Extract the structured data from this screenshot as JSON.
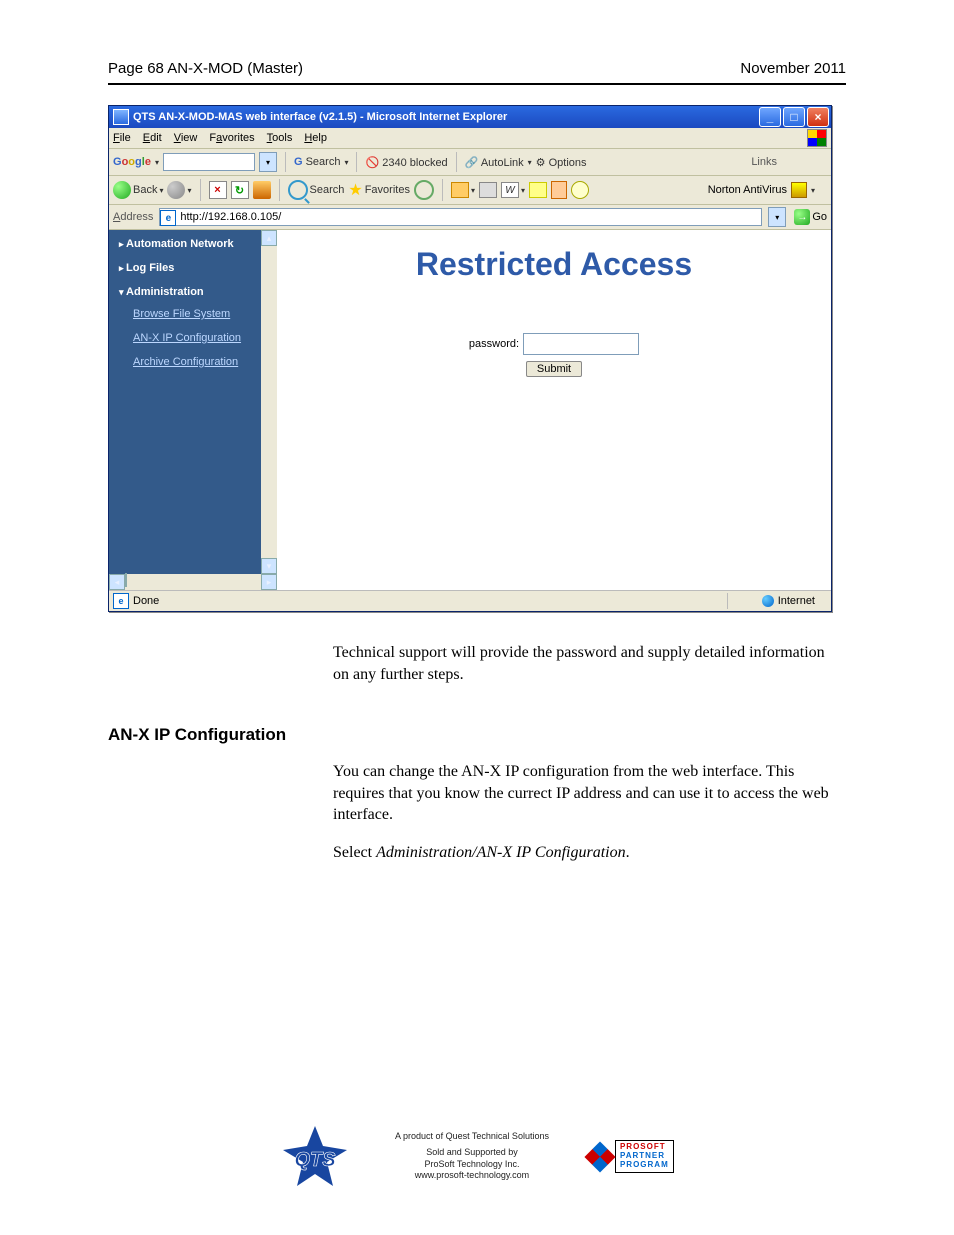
{
  "pageHeader": {
    "left": "Page  68  AN-X-MOD (Master)",
    "right": "November 2011"
  },
  "ieWindow": {
    "title": "QTS AN-X-MOD-MAS web interface (v2.1.5) - Microsoft Internet Explorer",
    "menu": {
      "file": "File",
      "edit": "Edit",
      "view": "View",
      "favorites": "Favorites",
      "tools": "Tools",
      "help": "Help"
    },
    "googleBar": {
      "search": "Search",
      "blocked": "2340 blocked",
      "autolink": "AutoLink",
      "options": "Options",
      "links": "Links"
    },
    "toolbar": {
      "back": "Back",
      "search": "Search",
      "favorites": "Favorites",
      "norton": "Norton AntiVirus"
    },
    "address": {
      "label": "Address",
      "url": "http://192.168.0.105/",
      "go": "Go"
    },
    "sidebar": {
      "automation": "Automation Network",
      "log": "Log Files",
      "admin": "Administration",
      "items": {
        "browse": "Browse File System",
        "ipconfig": "AN-X IP Configuration",
        "archive": "Archive Configuration"
      }
    },
    "content": {
      "heading": "Restricted Access",
      "pwLabel": "password:",
      "submit": "Submit"
    },
    "status": {
      "done": "Done",
      "zone": "Internet"
    }
  },
  "bodyText": {
    "p1": "Technical support will provide the password and supply detailed information on any further steps.",
    "heading": "AN-X IP Configuration",
    "p2": "You can change the AN-X IP configuration from the web interface.  This requires that you know the currect IP address and can use it to access the web interface.",
    "p3_a": "Select ",
    "p3_b": "Administration/AN-X IP Configuration",
    "p3_c": "."
  },
  "footer": {
    "line1": "A product of Quest Technical Solutions",
    "line2": "Sold and Supported by",
    "line3": "ProSoft Technology Inc.",
    "line4": "www.prosoft-technology.com",
    "p3": {
      "top": "PROSOFT",
      "mid": "PARTNER",
      "bot": "PROGRAM"
    }
  }
}
